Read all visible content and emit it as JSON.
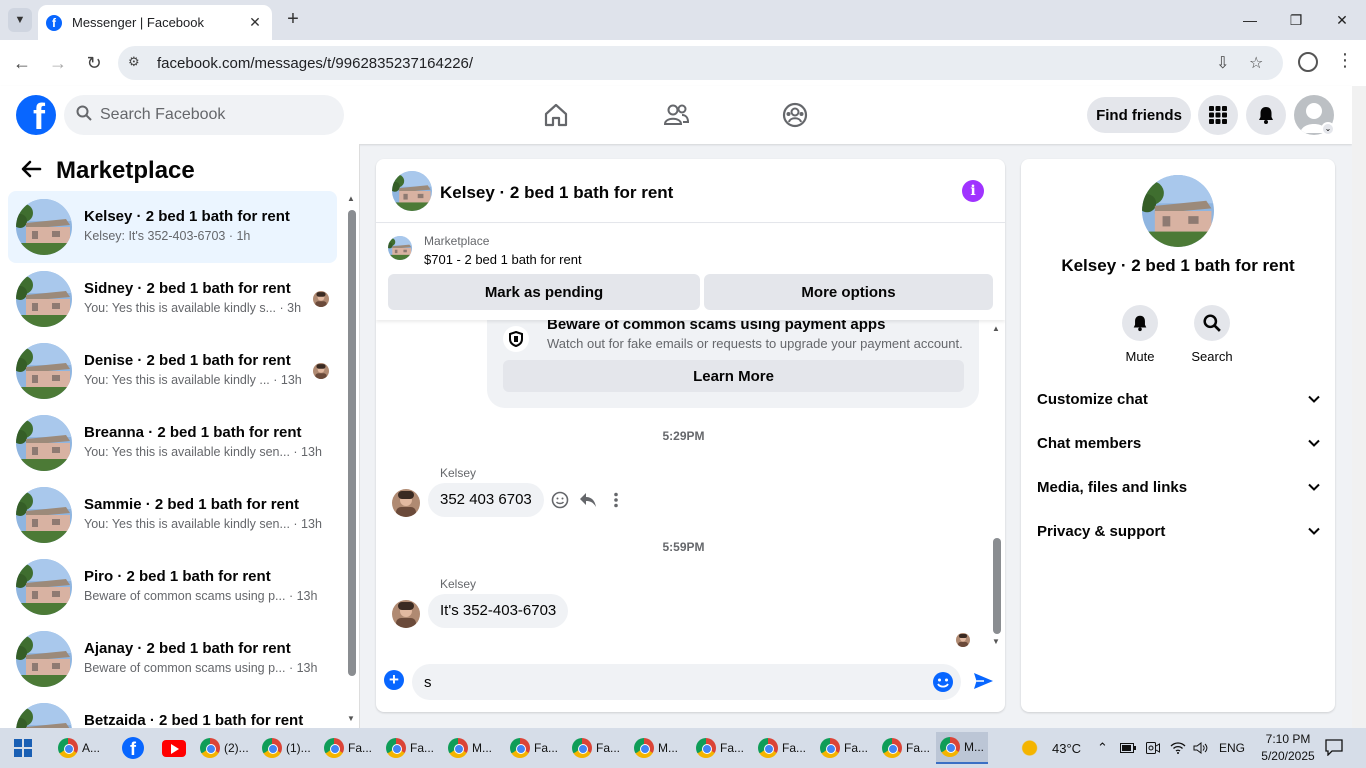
{
  "browser": {
    "tab_title": "Messenger | Facebook",
    "url": "facebook.com/messages/t/9962835237164226/"
  },
  "header": {
    "search_placeholder": "Search Facebook",
    "find_friends": "Find friends"
  },
  "sidebar": {
    "title": "Marketplace",
    "conversations": [
      {
        "name": "Kelsey · 2 bed 1 bath for rent",
        "preview": "Kelsey: It's 352-403-6703 · 1h",
        "active": true
      },
      {
        "name": "Sidney · 2 bed 1 bath for rent",
        "preview": "You: Yes this is available kindly s...",
        "time": "· 3h"
      },
      {
        "name": "Denise · 2 bed 1 bath for rent",
        "preview": "You: Yes this is available kindly ...",
        "time": "· 13h"
      },
      {
        "name": "Breanna · 2 bed 1 bath for rent",
        "preview": "You: Yes this is available kindly sen...",
        "time": "· 13h"
      },
      {
        "name": "Sammie · 2 bed 1 bath for rent",
        "preview": "You: Yes this is available kindly sen...",
        "time": "· 13h"
      },
      {
        "name": "Piro · 2 bed 1 bath for rent",
        "preview": "Beware of common scams using p...",
        "time": "· 13h"
      },
      {
        "name": "Ajanay · 2 bed 1 bath for rent",
        "preview": "Beware of common scams using p...",
        "time": "· 13h"
      },
      {
        "name": "Betzaida · 2 bed 1 bath for rent",
        "preview": "",
        "time": ""
      }
    ]
  },
  "chat": {
    "title": "Kelsey · 2 bed 1 bath for rent",
    "marketplace_label": "Marketplace",
    "listing": "$701 - 2 bed 1 bath for rent",
    "mark_pending": "Mark as pending",
    "more_options": "More options",
    "scam_title": "Beware of common scams using payment apps",
    "scam_text": "Watch out for fake emails or requests to upgrade your payment account.",
    "learn_more": "Learn More",
    "messages": [
      {
        "time": "5:29PM",
        "sender": "Kelsey",
        "text": "352 403 6703"
      },
      {
        "time": "5:59PM",
        "sender": "Kelsey",
        "text": "It's 352-403-6703"
      }
    ],
    "composer_value": "s"
  },
  "details": {
    "title": "Kelsey · 2 bed 1 bath for rent",
    "mute": "Mute",
    "search": "Search",
    "sections": [
      "Customize chat",
      "Chat members",
      "Media, files and links",
      "Privacy & support"
    ]
  },
  "taskbar": {
    "items": [
      "A...",
      "",
      "",
      "(2)...",
      "(1)...",
      "Fa...",
      "Fa...",
      "M...",
      "Fa...",
      "Fa...",
      "M...",
      "Fa...",
      "Fa...",
      "Fa...",
      "Fa...",
      "M..."
    ],
    "temperature": "43°C",
    "language": "ENG",
    "time": "7:10 PM",
    "date": "5/20/2025"
  },
  "colors": {
    "fb_blue": "#0866ff",
    "messenger_purple": "#a033ff",
    "active_conv": "#ebf5ff"
  }
}
